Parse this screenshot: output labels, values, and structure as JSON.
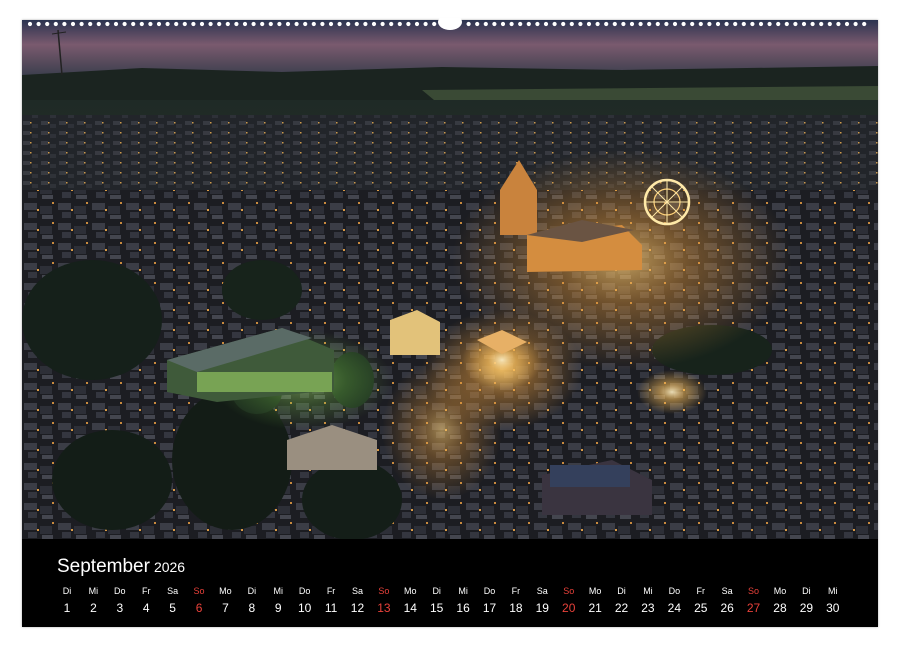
{
  "calendar": {
    "month": "September",
    "year": "2026",
    "sunday_color": "#e8413a",
    "days": [
      {
        "wd": "Di",
        "num": "1"
      },
      {
        "wd": "Mi",
        "num": "2"
      },
      {
        "wd": "Do",
        "num": "3"
      },
      {
        "wd": "Fr",
        "num": "4"
      },
      {
        "wd": "Sa",
        "num": "5"
      },
      {
        "wd": "So",
        "num": "6",
        "sunday": true
      },
      {
        "wd": "Mo",
        "num": "7"
      },
      {
        "wd": "Di",
        "num": "8"
      },
      {
        "wd": "Mi",
        "num": "9"
      },
      {
        "wd": "Do",
        "num": "10"
      },
      {
        "wd": "Fr",
        "num": "11"
      },
      {
        "wd": "Sa",
        "num": "12"
      },
      {
        "wd": "So",
        "num": "13",
        "sunday": true
      },
      {
        "wd": "Mo",
        "num": "14"
      },
      {
        "wd": "Di",
        "num": "15"
      },
      {
        "wd": "Mi",
        "num": "16"
      },
      {
        "wd": "Do",
        "num": "17"
      },
      {
        "wd": "Fr",
        "num": "18"
      },
      {
        "wd": "Sa",
        "num": "19"
      },
      {
        "wd": "So",
        "num": "20",
        "sunday": true
      },
      {
        "wd": "Mo",
        "num": "21"
      },
      {
        "wd": "Di",
        "num": "22"
      },
      {
        "wd": "Mi",
        "num": "23"
      },
      {
        "wd": "Do",
        "num": "24"
      },
      {
        "wd": "Fr",
        "num": "25"
      },
      {
        "wd": "Sa",
        "num": "26"
      },
      {
        "wd": "So",
        "num": "27",
        "sunday": true
      },
      {
        "wd": "Mo",
        "num": "28"
      },
      {
        "wd": "Di",
        "num": "29"
      },
      {
        "wd": "Mi",
        "num": "30"
      }
    ]
  }
}
